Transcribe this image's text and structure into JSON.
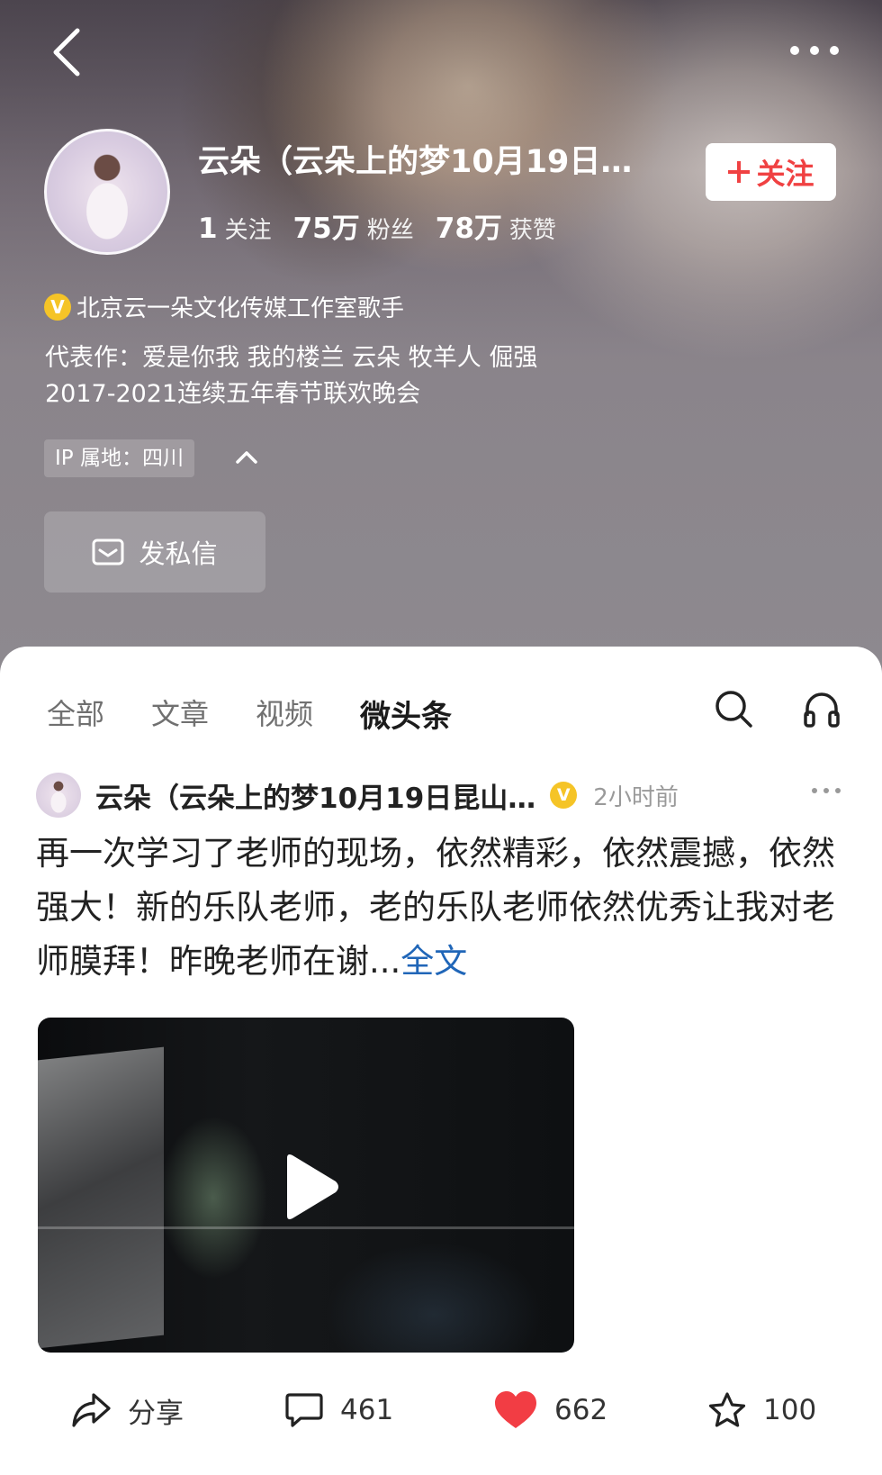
{
  "header": {
    "name": "云朵（云朵上的梦10月19日…",
    "follow_label": "关注",
    "stats": [
      {
        "num": "1",
        "label": "关注"
      },
      {
        "num": "75万",
        "label": "粉丝"
      },
      {
        "num": "78万",
        "label": "获赞"
      }
    ],
    "verify_badge": "V",
    "verification": "北京云一朵文化传媒工作室歌手",
    "bio_line1": "代表作：爱是你我  我的楼兰  云朵  牧羊人  倔强",
    "bio_line2": "2017-2021连续五年春节联欢晚会",
    "ip_location": "IP 属地：四川",
    "dm_label": "发私信"
  },
  "tabs": [
    {
      "label": "全部",
      "active": false
    },
    {
      "label": "文章",
      "active": false
    },
    {
      "label": "视频",
      "active": false
    },
    {
      "label": "微头条",
      "active": true
    }
  ],
  "post": {
    "author": "云朵（云朵上的梦10月19日昆山…",
    "verify_badge": "V",
    "time": "2小时前",
    "text": "再一次学习了老师的现场，依然精彩，依然震撼，依然强大！新的乐队老师，老的乐队老师依然优秀让我对老师膜拜！昨晚老师在谢...",
    "full_link": "全文",
    "actions": {
      "share_label": "分享",
      "comments": "461",
      "likes": "662",
      "favorites": "100"
    }
  },
  "colors": {
    "accent_red": "#f04142",
    "link_blue": "#2066b8",
    "verify_gold": "#f5c427"
  },
  "icons": [
    "back-arrow-icon",
    "more-dots-icon",
    "plus-icon",
    "chevron-up-icon",
    "mail-icon",
    "search-icon",
    "headphones-icon",
    "play-icon",
    "share-icon",
    "comment-icon",
    "heart-icon",
    "star-icon"
  ]
}
